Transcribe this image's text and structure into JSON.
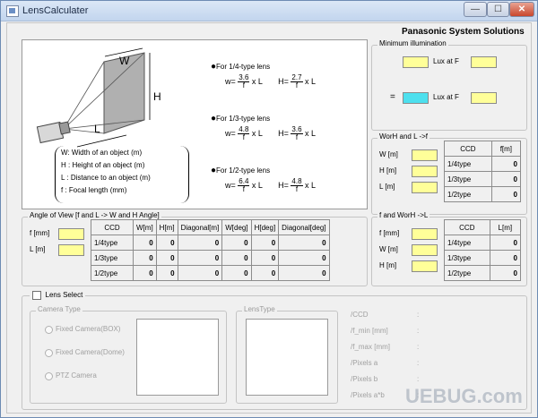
{
  "window": {
    "title": "LensCalculater",
    "minimize": "—",
    "maximize": "☐",
    "close": "✕"
  },
  "brand": "Panasonic System Solutions",
  "diagram": {
    "w_label": "W",
    "h_label": "H",
    "l_label": "L",
    "legend": [
      "W: Width of an object (m)",
      "H : Height of an object (m)",
      "L : Distance to an object (m)",
      "f : Focal length  (mm)"
    ],
    "formulas": [
      {
        "title": "For 1/4-type lens",
        "w_num": "3.6",
        "h_num": "2.7"
      },
      {
        "title": "For 1/3-type lens",
        "w_num": "4.8",
        "h_num": "3.6"
      },
      {
        "title": "For 1/2-type lens",
        "w_num": "6.4",
        "h_num": "4.8"
      }
    ],
    "w_eq": "w=",
    "h_eq": "H=",
    "f": "f",
    "xl": "x L"
  },
  "min_illum": {
    "title": "Minimum illumination",
    "lux_label": "Lux at F",
    "equals": "="
  },
  "worh_l_f": {
    "title": "WorH and L ->f",
    "labels": [
      "W [m]",
      "H [m]",
      "L [m]"
    ],
    "headers": [
      "CCD",
      "f[m]"
    ],
    "rows": [
      [
        "1/4type",
        "0"
      ],
      [
        "1/3type",
        "0"
      ],
      [
        "1/2type",
        "0"
      ]
    ]
  },
  "f_worh_l": {
    "title": "f and WorH ->L",
    "labels": [
      "f [mm]",
      "W [m]",
      "H [m]"
    ],
    "headers": [
      "CCD",
      "L[m]"
    ],
    "rows": [
      [
        "1/4type",
        "0"
      ],
      [
        "1/3type",
        "0"
      ],
      [
        "1/2type",
        "0"
      ]
    ]
  },
  "angle": {
    "title": "Angle of View [f and L -> W and H Angle]",
    "labels": [
      "f [mm]",
      "L [m]"
    ],
    "headers": [
      "CCD",
      "W[m]",
      "H[m]",
      "Diagonal[m]",
      "W[deg]",
      "H[deg]",
      "Diagonal[deg]"
    ],
    "rows": [
      [
        "1/4type",
        "0",
        "0",
        "0",
        "0",
        "0",
        "0"
      ],
      [
        "1/3type",
        "0",
        "0",
        "0",
        "0",
        "0",
        "0"
      ],
      [
        "1/2type",
        "0",
        "0",
        "0",
        "0",
        "0",
        "0"
      ]
    ]
  },
  "lens_select": {
    "label": "Lens Select",
    "camera_type": "Camera Type",
    "radios": [
      "Fixed Camera(BOX)",
      "Fixed Camera(Dome)",
      "PTZ Camera"
    ],
    "lens_type": "LensType",
    "info": [
      "/CCD",
      "/f_min [mm]",
      "/f_max [mm]",
      "/Pixels a",
      "/Pixels b",
      "/Pixels a*b"
    ],
    "info_colons": [
      ":",
      ":",
      ":",
      ":",
      ":",
      ":"
    ]
  },
  "watermark": "UEBUG.com"
}
